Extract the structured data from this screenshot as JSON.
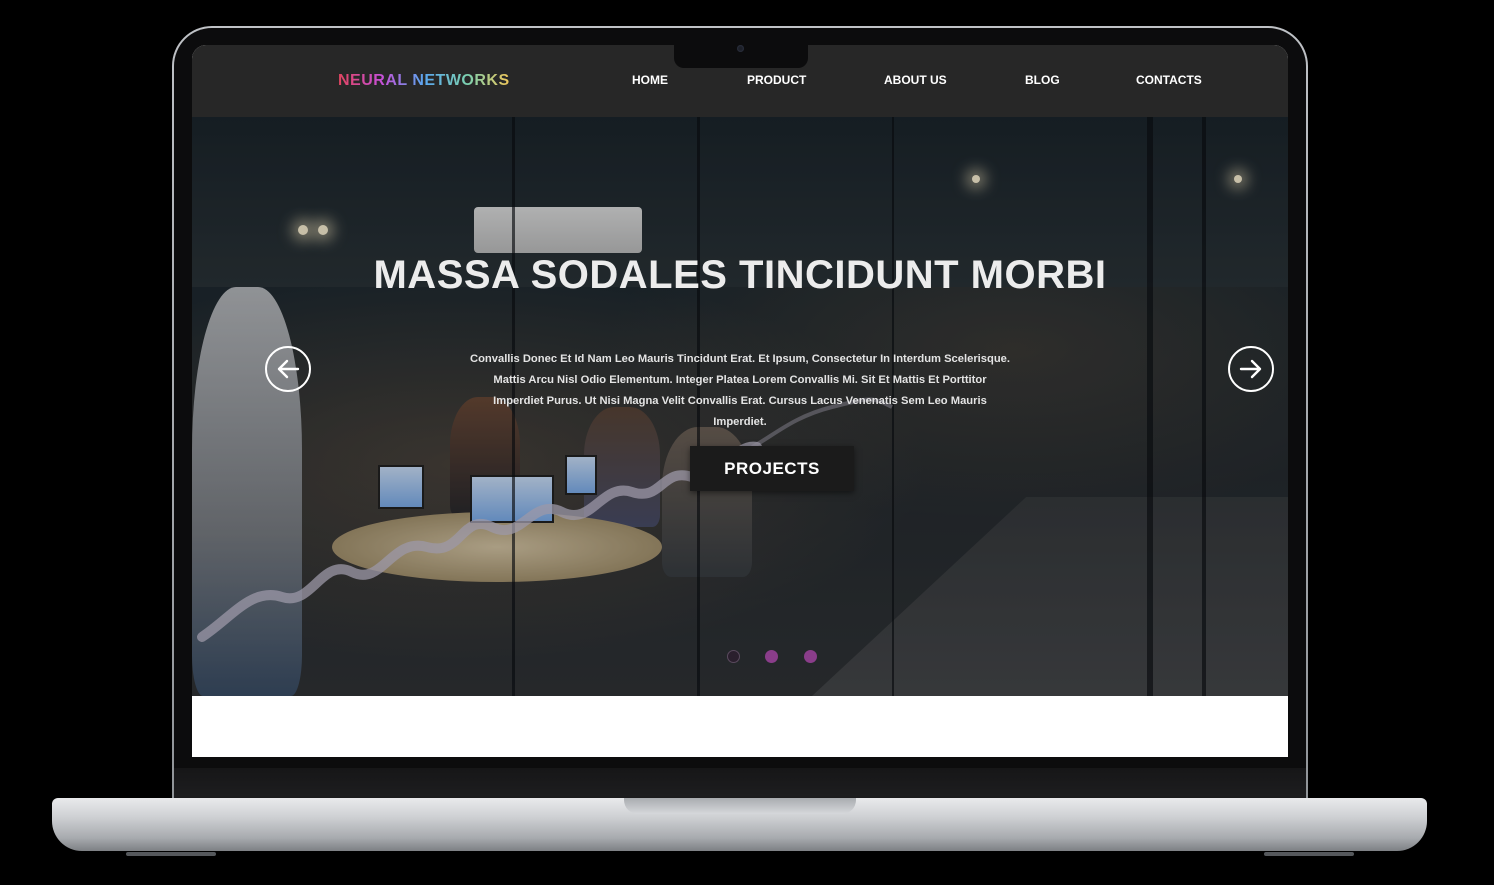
{
  "nav": {
    "brand": "NEURAL NETWORKS",
    "links": [
      "HOME",
      "PRODUCT",
      "ABOUT US",
      "BLOG",
      "CONTACTS"
    ]
  },
  "hero": {
    "title": "MASSA SODALES TINCIDUNT MORBI",
    "text": "Convallis Donec Et Id Nam Leo Mauris Tincidunt Erat. Et Ipsum, Consectetur In Interdum Scelerisque. Mattis Arcu Nisl Odio Elementum. Integer Platea Lorem Convallis Mi. Sit Et Mattis Et Porttitor Imperdiet Purus. Ut Nisi Magna Velit Convallis Erat. Cursus Lacus Venenatis Sem Leo Mauris Imperdiet.",
    "cta_label": "PROJECTS",
    "prev_icon": "arrow-left-circle-icon",
    "next_icon": "arrow-right-circle-icon",
    "slides_total": 3,
    "active_slide": 1
  },
  "colors": {
    "navbar_bg": "#272727",
    "button_bg": "#1b1b1b",
    "dot_active": "#2a1f2d",
    "dot_inactive": "#8a3d8a",
    "device_frame": "#bfc2c6"
  }
}
